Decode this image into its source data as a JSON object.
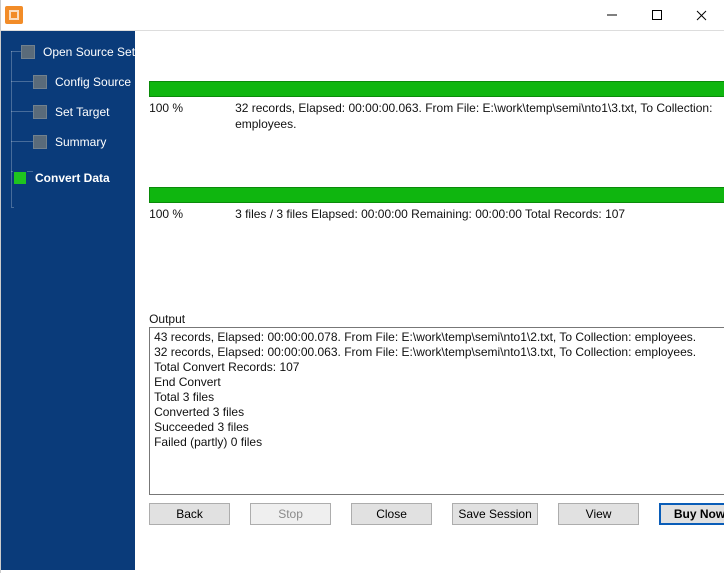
{
  "sidebar": {
    "items": [
      {
        "label": "Open Source Set"
      },
      {
        "label": "Config Source"
      },
      {
        "label": "Set Target"
      },
      {
        "label": "Summary"
      },
      {
        "label": "Convert Data"
      }
    ]
  },
  "progress1": {
    "pct": "100 %",
    "text": "32 records,    Elapsed: 00:00:00.063.    From File: E:\\work\\temp\\semi\\nto1\\3.txt,    To Collection: employees."
  },
  "progress2": {
    "pct": "100 %",
    "text": "3 files / 3 files    Elapsed: 00:00:00    Remaining: 00:00:00    Total Records: 107"
  },
  "output": {
    "label": "Output",
    "lines": [
      "43 records,    Elapsed: 00:00:00.078.    From File: E:\\work\\temp\\semi\\nto1\\2.txt,    To Collection: employees.",
      "32 records,    Elapsed: 00:00:00.063.    From File: E:\\work\\temp\\semi\\nto1\\3.txt,    To Collection: employees.",
      "Total Convert Records: 107",
      "End Convert",
      "Total 3 files",
      "Converted 3 files",
      "Succeeded 3 files",
      "Failed (partly) 0 files"
    ]
  },
  "buttons": {
    "back": "Back",
    "stop": "Stop",
    "close": "Close",
    "save": "Save Session",
    "view": "View",
    "buy": "Buy Now"
  }
}
